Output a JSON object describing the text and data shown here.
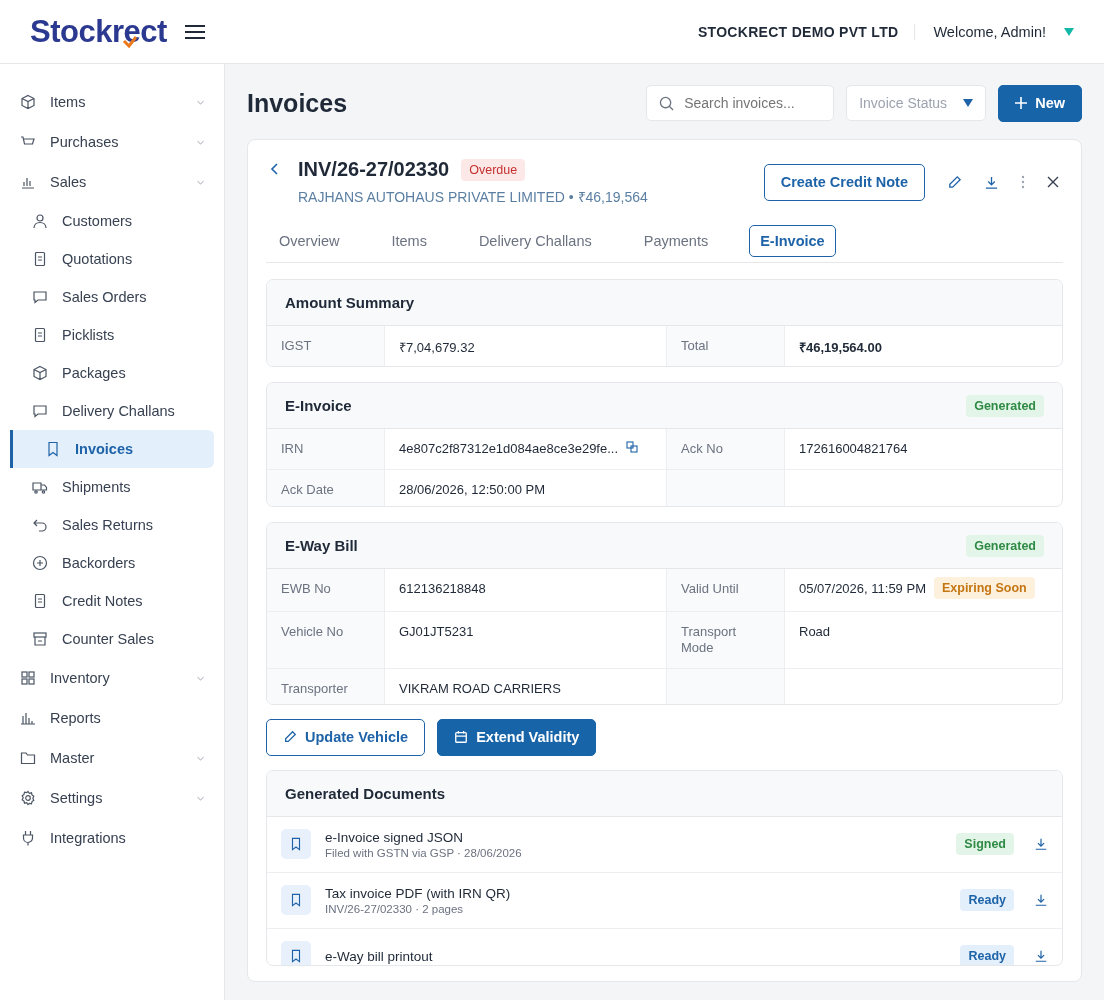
{
  "header": {
    "logo": "Stockrect",
    "company": "STOCKRECT DEMO PVT LTD",
    "welcome": "Welcome, Admin!"
  },
  "sidebar": {
    "items": [
      {
        "label": "Items",
        "chevron": true,
        "selected": false
      },
      {
        "label": "Purchases",
        "chevron": true,
        "selected": false
      },
      {
        "label": "Sales",
        "chevron": true,
        "selected": false,
        "children": [
          {
            "label": "Customers",
            "selected": false
          },
          {
            "label": "Quotations",
            "selected": false
          },
          {
            "label": "Sales Orders",
            "selected": false
          },
          {
            "label": "Picklists",
            "selected": false
          },
          {
            "label": "Packages",
            "selected": false
          },
          {
            "label": "Delivery Challans",
            "selected": false
          },
          {
            "label": "Invoices",
            "selected": true
          },
          {
            "label": "Shipments",
            "selected": false
          },
          {
            "label": "Sales Returns",
            "selected": false
          },
          {
            "label": "Backorders",
            "selected": false
          },
          {
            "label": "Credit Notes",
            "selected": false
          },
          {
            "label": "Counter Sales",
            "selected": false
          }
        ]
      },
      {
        "label": "Inventory",
        "chevron": true,
        "selected": false
      },
      {
        "label": "Reports",
        "chevron": false,
        "selected": false
      },
      {
        "label": "Master",
        "chevron": true,
        "selected": false
      },
      {
        "label": "Settings",
        "chevron": true,
        "selected": false
      },
      {
        "label": "Integrations",
        "chevron": false,
        "selected": false
      }
    ]
  },
  "page": {
    "title": "Invoices",
    "search": {
      "placeholder": "Search invoices..."
    },
    "status_filter": "Invoice Status",
    "new_button": "New"
  },
  "invoice": {
    "number": "INV/26-27/02330",
    "status": {
      "text": "Overdue",
      "kind": "danger"
    },
    "customer": "RAJHANS AUTOHAUS PRIVATE LIMITED • ₹46,19,564",
    "credit_button": "Create Credit Note"
  },
  "tabs": [
    {
      "label": "Overview",
      "selected": false
    },
    {
      "label": "Items",
      "selected": false
    },
    {
      "label": "Delivery Challans",
      "selected": false
    },
    {
      "label": "Payments",
      "selected": false
    },
    {
      "label": "E-Invoice",
      "selected": true
    }
  ],
  "sections": [
    {
      "title": "Amount Summary",
      "rows": [
        [
          {
            "label": "IGST",
            "value": "₹7,04,679.32"
          },
          {
            "label": "Total",
            "value": "₹46,19,564.00",
            "bold": true
          }
        ]
      ]
    },
    {
      "title": "E-Invoice",
      "badge": {
        "text": "Generated",
        "kind": "success"
      },
      "rows": [
        [
          {
            "label": "IRN",
            "value": "4e807c2f87312e1d084ae8ce3e29fe...",
            "copy": true
          },
          {
            "label": "Ack No",
            "value": "172616004821764"
          }
        ],
        [
          {
            "label": "Ack Date",
            "value": "28/06/2026, 12:50:00 PM"
          },
          null
        ]
      ]
    },
    {
      "title": "E-Way Bill",
      "badge": {
        "text": "Generated",
        "kind": "success"
      },
      "rows": [
        [
          {
            "label": "EWB No",
            "value": "612136218848"
          },
          {
            "label": "Valid Until",
            "value": "05/07/2026, 11:59 PM",
            "badge": {
              "text": "Expiring Soon",
              "kind": "warning"
            }
          }
        ],
        [
          {
            "label": "Vehicle No",
            "value": "GJ01JT5231"
          },
          {
            "label": "Transport Mode",
            "value": "Road"
          }
        ],
        [
          {
            "label": "Transporter",
            "value": "VIKRAM ROAD CARRIERS"
          },
          null
        ]
      ]
    }
  ],
  "actions": [
    {
      "label": "Update Vehicle",
      "kind": "outline"
    },
    {
      "label": "Extend Validity",
      "kind": "primary"
    }
  ],
  "documents": {
    "title": "Generated Documents",
    "items": [
      {
        "name": "e-Invoice signed JSON",
        "detail": "Filed with GSTN via GSP · 28/06/2026",
        "badge": {
          "text": "Signed",
          "kind": "success"
        }
      },
      {
        "name": "Tax invoice PDF (with IRN QR)",
        "detail": "INV/26-27/02330 · 2 pages",
        "badge": {
          "text": "Ready",
          "kind": "info"
        }
      },
      {
        "name": "e-Way bill printout",
        "badge": {
          "text": "Ready",
          "kind": "info"
        }
      }
    ]
  }
}
